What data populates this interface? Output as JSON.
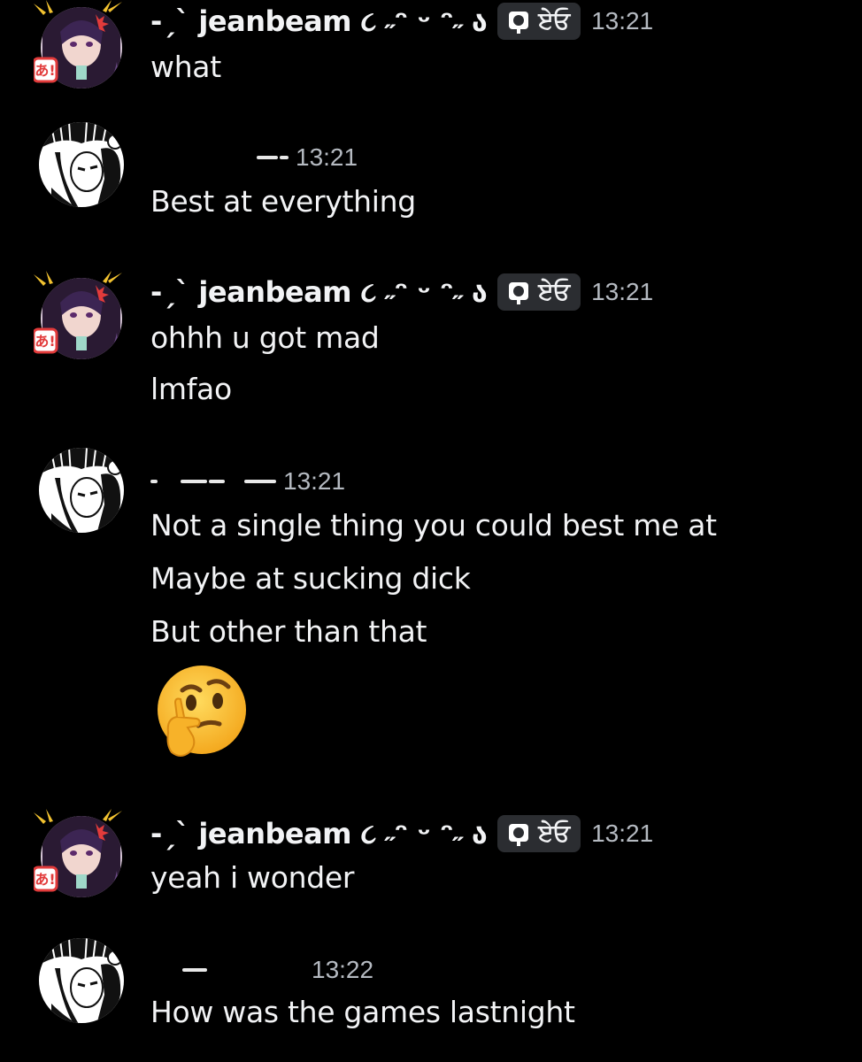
{
  "messages": [
    {
      "author": "-ˏˋ jeanbeam ૮ ˶ᵔ ᵕ ᵔ˶ ა",
      "tag": "ਏਓ",
      "time": "13:21",
      "lines": [
        "what"
      ]
    },
    {
      "author_redacted": true,
      "time": "13:21",
      "lines": [
        "Best at everything"
      ]
    },
    {
      "author": "-ˏˋ jeanbeam ૮ ˶ᵔ ᵕ ᵔ˶ ა",
      "tag": "ਏਓ",
      "time": "13:21",
      "lines": [
        "ohhh u got mad",
        "lmfao"
      ]
    },
    {
      "author_redacted": true,
      "time": "13:21",
      "lines": [
        "Not a single thing you could best me at",
        "Maybe at sucking dick",
        "But other than that"
      ],
      "emoji": "thinking-face-emoji"
    },
    {
      "author": "-ˏˋ jeanbeam ૮ ˶ᵔ ᵕ ᵔ˶ ა",
      "tag": "ਏਓ",
      "time": "13:21",
      "lines": [
        "yeah i wonder"
      ]
    },
    {
      "author_redacted": true,
      "time": "13:22",
      "lines": [
        "How was the games lastnight"
      ]
    }
  ],
  "colors": {
    "background": "#000000",
    "text": "#f2f3f5",
    "timestamp": "#b5bac1",
    "badge_bg": "#2b2d31"
  },
  "icons": {
    "avatar_a": "anime-girl-avatar",
    "avatar_b": "manga-boy-avatar",
    "tag": "server-tag-icon"
  }
}
